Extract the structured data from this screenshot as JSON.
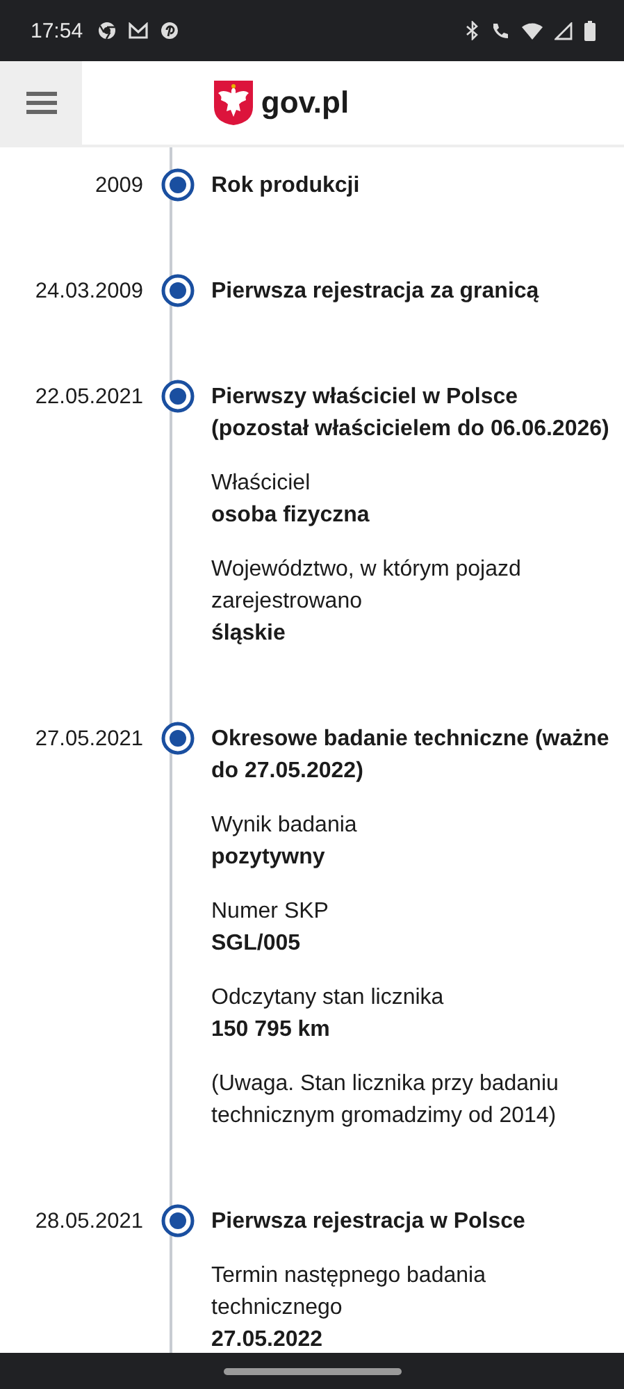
{
  "status_bar": {
    "time": "17:54"
  },
  "header": {
    "logo_text": "gov.pl"
  },
  "events": [
    {
      "date": "2009",
      "title": "Rok produkcji"
    },
    {
      "date": "24.03.2009",
      "title": "Pierwsza rejestracja za granicą"
    },
    {
      "date": "22.05.2021",
      "title": "Pierwszy właściciel w Polsce (pozostał właścicielem do 06.06.2026)",
      "details": [
        {
          "kind": "field",
          "label": "Właściciel",
          "value": "osoba fizyczna"
        },
        {
          "kind": "field",
          "label": "Województwo, w którym pojazd zarejestrowano",
          "value": "śląskie"
        }
      ]
    },
    {
      "date": "27.05.2021",
      "title": "Okresowe badanie techniczne (ważne do 27.05.2022)",
      "details": [
        {
          "kind": "field",
          "label": "Wynik badania",
          "value": "pozytywny"
        },
        {
          "kind": "field",
          "label": "Numer SKP",
          "value": "SGL/005"
        },
        {
          "kind": "field",
          "label": "Odczytany stan licznika",
          "value": "150 795 km"
        },
        {
          "kind": "note",
          "text": "(Uwaga. Stan licznika przy badaniu technicznym gromadzimy od 2014)"
        }
      ]
    },
    {
      "date": "28.05.2021",
      "title": "Pierwsza rejestracja w Polsce",
      "details": [
        {
          "kind": "field",
          "label": "Termin następnego badania technicznego",
          "value": "27.05.2022"
        }
      ]
    }
  ]
}
